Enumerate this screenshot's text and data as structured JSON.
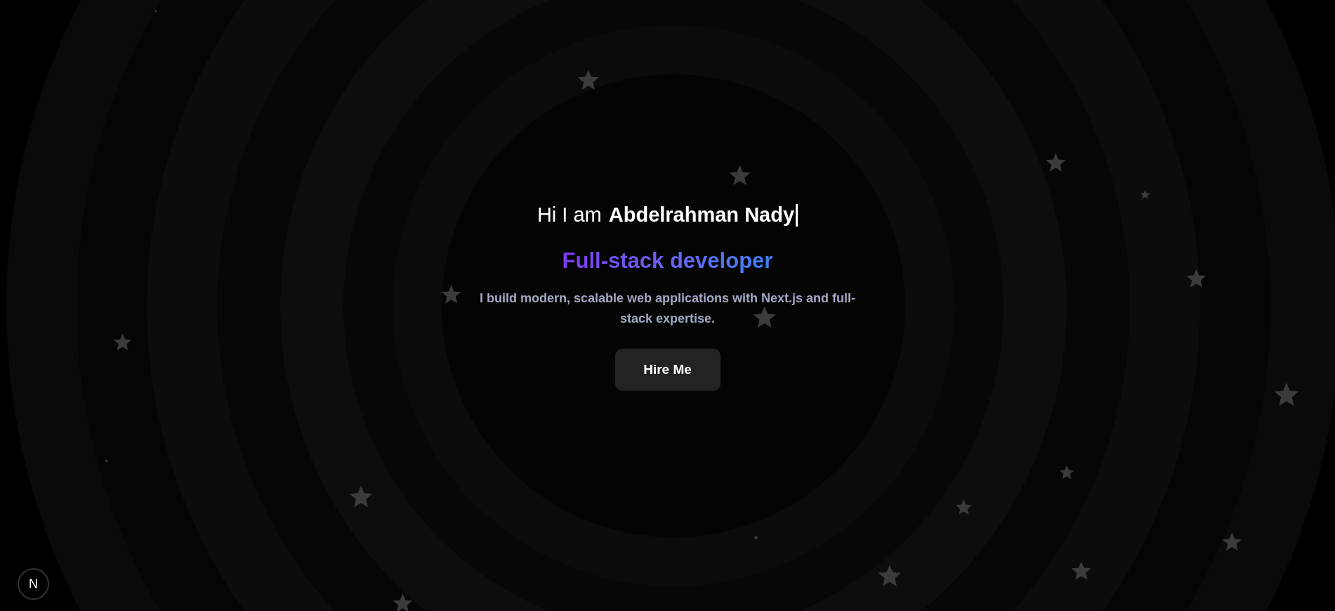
{
  "hero": {
    "greeting": "Hi I am",
    "name": "Abdelrahman Nady",
    "cursor": true,
    "role": "Full-stack developer",
    "description": "I build modern, scalable web applications with Next.js and full-stack expertise.",
    "button": "Hire Me"
  },
  "dev_badge": {
    "label": "N"
  }
}
